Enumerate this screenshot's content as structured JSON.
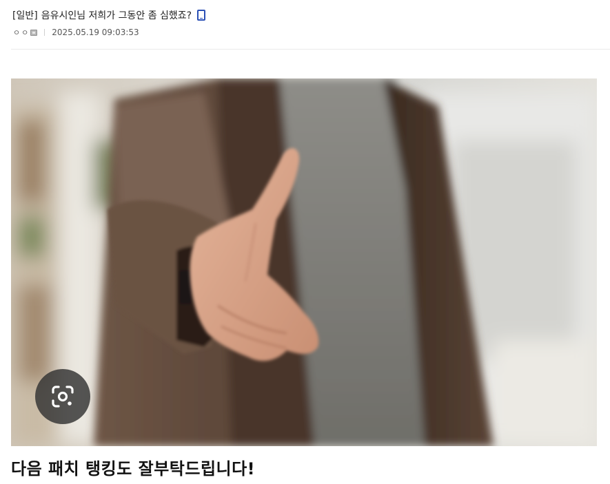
{
  "post": {
    "category": "[일반]",
    "title": "음유시인님 저희가 그동안 좀 심했죠?",
    "mobile_icon": "mobile-phone-icon",
    "author_nick": "ㅇㅇ",
    "author_icon": "fixed-nick-icon",
    "date": "2025.05.19 09:03:53"
  },
  "image": {
    "subject": "reaching-hand-handshake-photo",
    "lens_icon": "google-lens-icon"
  },
  "body": {
    "caption": "다음 패치 탱킹도 잘부탁드립니다!"
  },
  "colors": {
    "mobile_icon": "#2a4fb5",
    "header_border": "#ebebeb"
  }
}
